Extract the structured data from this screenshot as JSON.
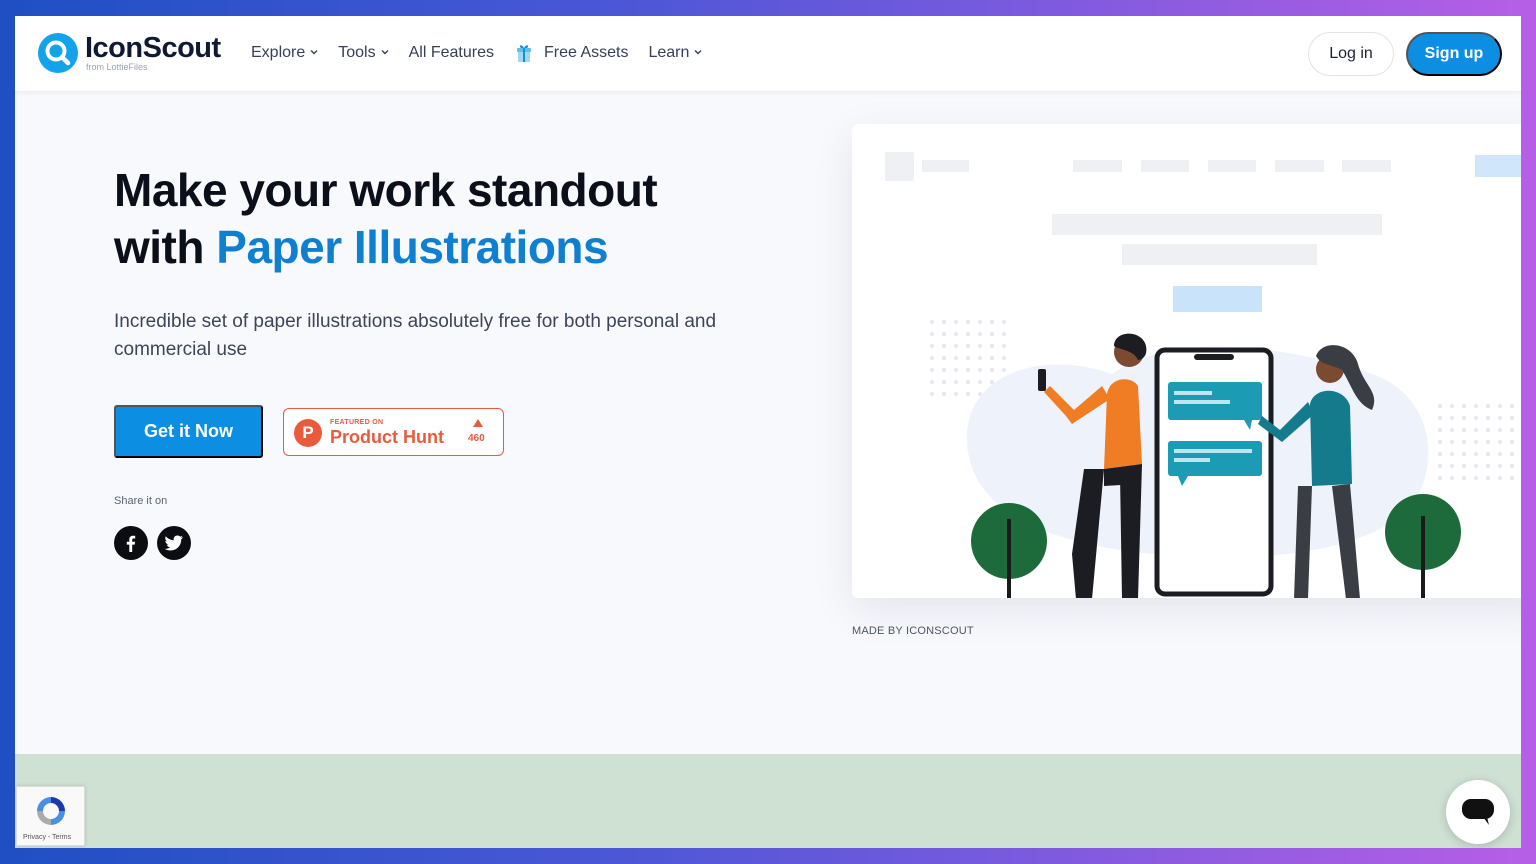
{
  "brand": {
    "name": "IconScout",
    "sub": "from LottieFiles",
    "color_primary": "#0c8ee3",
    "color_accent_text": "#0f7fcf"
  },
  "nav": {
    "items": [
      {
        "label": "Explore",
        "has_dropdown": true
      },
      {
        "label": "Tools",
        "has_dropdown": true
      },
      {
        "label": "All Features",
        "has_dropdown": false
      },
      {
        "label": "Free Assets",
        "has_dropdown": false,
        "icon": "gift-icon"
      },
      {
        "label": "Learn",
        "has_dropdown": true
      }
    ],
    "login_label": "Log in",
    "signup_label": "Sign up"
  },
  "hero": {
    "headline_line1": "Make your work standout",
    "headline_prefix": "with",
    "headline_accent": "Paper Illustrations",
    "subtext": "Incredible set of paper illustrations absolutely free for both personal and commercial use",
    "cta_label": "Get it Now",
    "producthunt": {
      "featured": "FEATURED ON",
      "name": "Product Hunt",
      "votes": "460",
      "color": "#ea5a3d"
    },
    "share_label": "Share it on",
    "social": [
      "facebook-icon",
      "twitter-icon"
    ]
  },
  "illustration": {
    "caption": "MADE BY ICONSCOUT"
  },
  "footer_widgets": {
    "recaptcha_text": "Privacy - Terms",
    "band_color": "#cfe1d3"
  }
}
